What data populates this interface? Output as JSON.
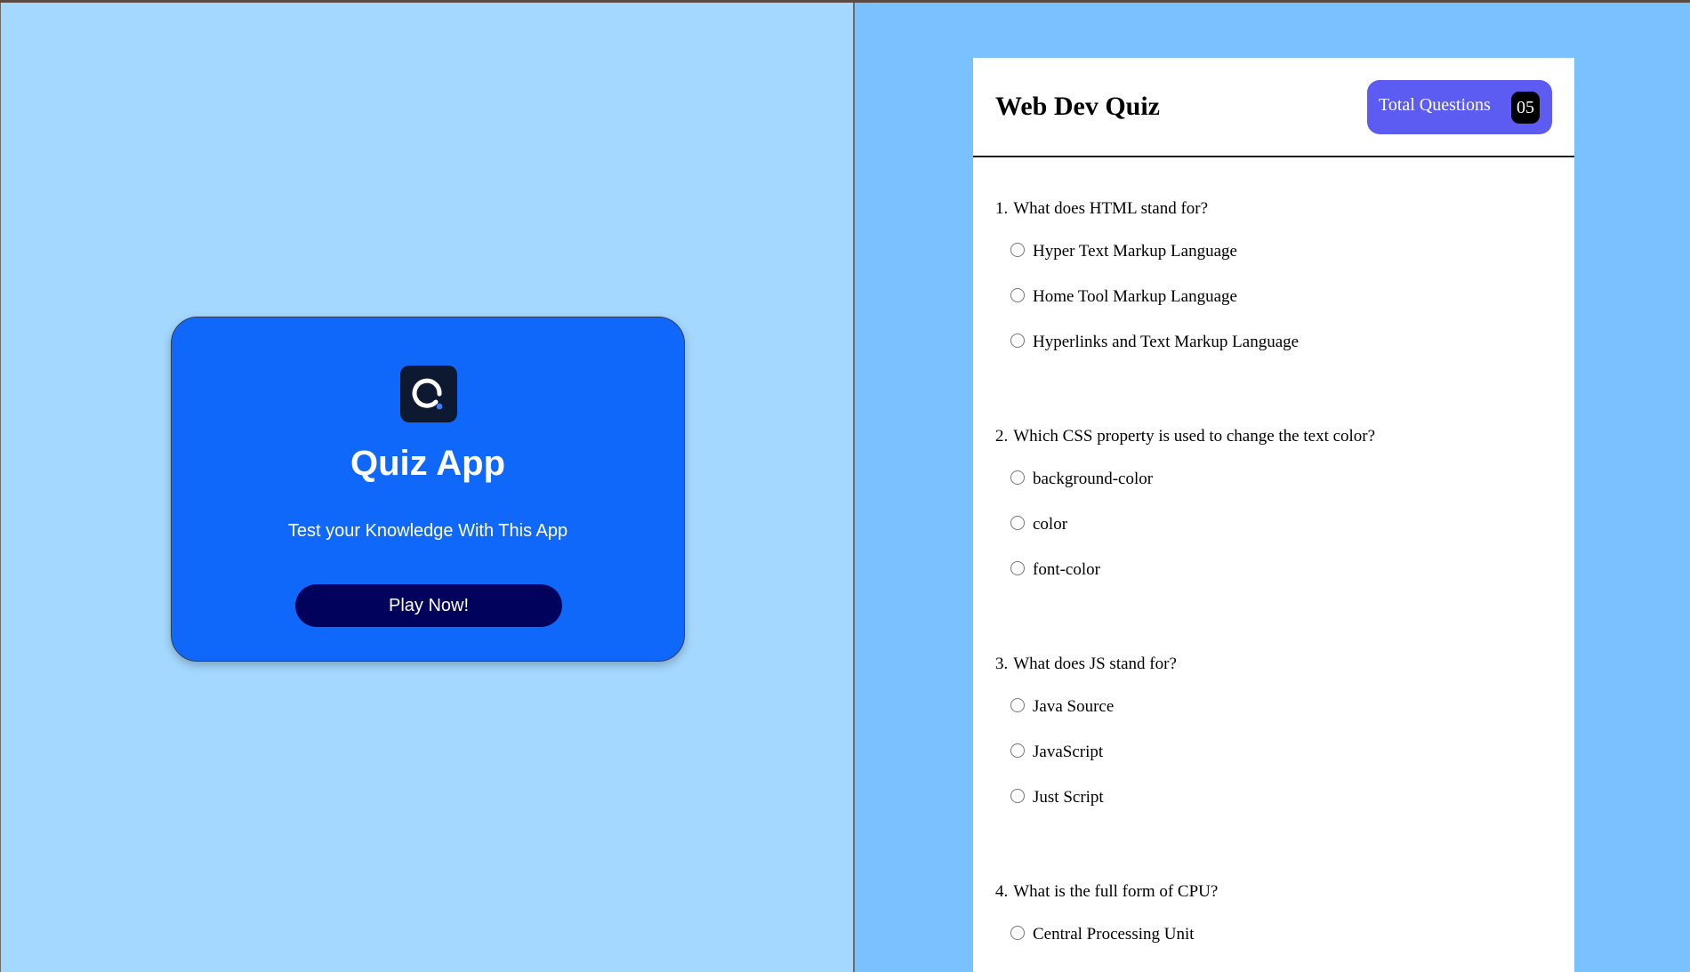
{
  "start_screen": {
    "logo_icon": "quiz-logo-icon",
    "title": "Quiz App",
    "subtitle": "Test your Knowledge With This App",
    "play_button": "Play Now!"
  },
  "quiz": {
    "title": "Web Dev Quiz",
    "total_label": "Total Questions",
    "total_count": "05",
    "questions": [
      {
        "number": "1.",
        "text": "What does HTML stand for?",
        "options": [
          "Hyper Text Markup Language",
          "Home Tool Markup Language",
          "Hyperlinks and Text Markup Language"
        ]
      },
      {
        "number": "2.",
        "text": "Which CSS property is used to change the text color?",
        "options": [
          "background-color",
          "color",
          "font-color"
        ]
      },
      {
        "number": "3.",
        "text": "What does JS stand for?",
        "options": [
          "Java Source",
          "JavaScript",
          "Just Script"
        ]
      },
      {
        "number": "4.",
        "text": "What is the full form of CPU?",
        "options": [
          "Central Processing Unit"
        ]
      }
    ]
  },
  "colors": {
    "left_background": "#a5d8ff",
    "right_background": "#7ac2ff",
    "card_blue": "#1068fa",
    "play_button_navy": "#00025c",
    "badge_purple": "#5c5cf2"
  }
}
